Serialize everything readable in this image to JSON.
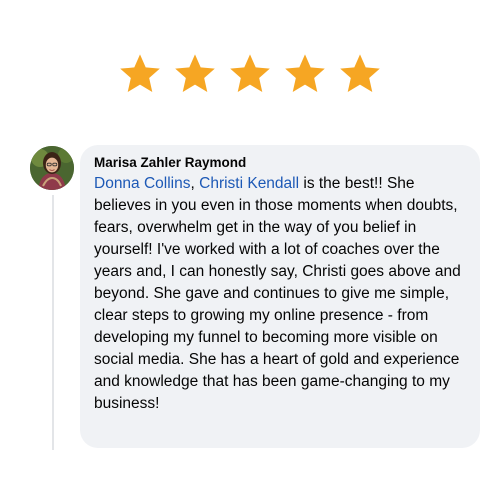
{
  "rating": {
    "stars": 5,
    "max": 5,
    "star_color": "#f6a623",
    "icon": "star-icon"
  },
  "comment": {
    "author": "Marisa Zahler Raymond",
    "mentions": [
      "Donna Collins",
      "Christi Kendall"
    ],
    "mention_separator": ", ",
    "mention_color": "#1d59b6",
    "text": " is the best!! She believes in you even in those moments when doubts, fears, overwhelm get in the way of you belief in yourself! I've worked with a lot of coaches over the years and, I can honestly say, Christi goes above and beyond. She gave and continues to give me simple, clear steps to growing my online presence - from developing my funnel to becoming more visible on social media. She has a heart of gold and experience and knowledge that has been game-changing to my business!"
  },
  "colors": {
    "bubble_background": "#f0f2f5",
    "thread_line": "#e3e5e8"
  }
}
